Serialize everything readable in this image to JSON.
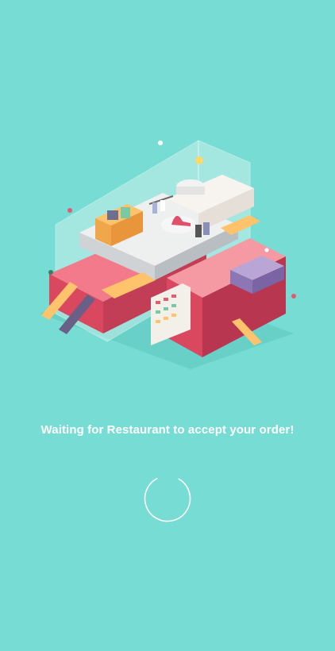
{
  "theme": {
    "background": "#76dcd4",
    "text_color": "#ffffff",
    "wall_pink": "#e45a72",
    "floor_white": "#eef0ef",
    "awning_yellow": "#ffc36b",
    "glass": "#c9f0ea"
  },
  "illustration": {
    "icon": "isometric-shopping-mall-illustration"
  },
  "status": {
    "message": "Waiting for Restaurant to accept your order!"
  },
  "loader": {
    "icon": "loading-spinner-icon"
  }
}
